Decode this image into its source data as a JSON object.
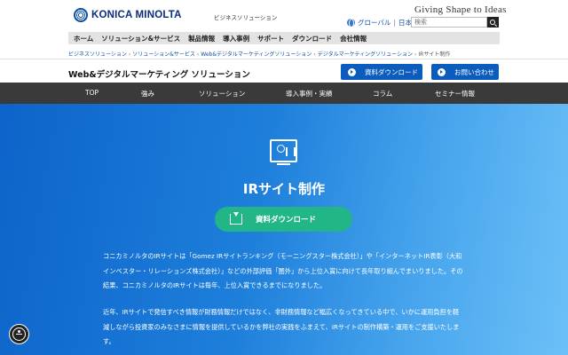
{
  "header": {
    "logo_text": "KONICA MINOLTA",
    "section_label": "ビジネスソリューション",
    "tagline": "Giving Shape to Ideas",
    "global_link": "グローバル",
    "separator": "|",
    "japan_link": "日本",
    "search_placeholder": "検索"
  },
  "main_nav": [
    "ホーム",
    "ソリューション&サービス",
    "製品情報",
    "導入事例",
    "サポート",
    "ダウンロード",
    "会社情報"
  ],
  "breadcrumb": {
    "items": [
      "ビジネスソリューション",
      "ソリューション&サービス",
      "Web&デジタルマーケティングソリューション",
      "デジタルマーケティングソリューション"
    ],
    "current": "IRサイト制作",
    "separator": "›"
  },
  "section_bar": {
    "title": "Web&デジタルマーケティング ソリューション",
    "download_button": "資料ダウンロード",
    "contact_button": "お問い合わせ"
  },
  "sub_nav": [
    "TOP",
    "強み",
    "ソリューション",
    "導入事例・実績",
    "コラム",
    "セミナー情報"
  ],
  "hero": {
    "icon": "monitor-coins-icon",
    "title": "IRサイト制作",
    "download_button": "資料ダウンロード",
    "paragraph1": "コニカミノルタのIRサイトは「Gomez IRサイトランキング（モーニングスター株式会社）」や「インターネットIR表彰（大和インベスター・リレーションズ株式会社）」などの外部評価「圏外」から上位入賞に向けて長年取り組んでまいりました。その結果、コニカミノルタのIRサイトは毎年、上位入賞できるまでになりました。",
    "paragraph2": "近年、IRサイトで発信すべき情報が財務情報だけではなく、非財務情報など幅広くなってきている中で、いかに運用負担を軽減しながら投資家のみなさまに情報を提供しているかを弊社の実践をふまえて、IRサイトの制作構築・運用をご支援いたします。"
  },
  "colors": {
    "brand_blue": "#0b5cbd",
    "hero_gradient_start": "#0d63c9",
    "hero_gradient_end": "#6cc0f7",
    "cta_green": "#21b587",
    "subnav_bg": "#3a3a3a"
  },
  "accessibility_button": "accessibility-icon"
}
